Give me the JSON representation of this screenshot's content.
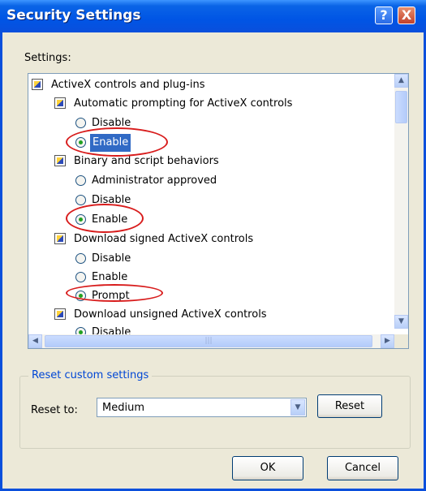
{
  "window": {
    "title": "Security Settings",
    "help_label": "?",
    "close_label": "X"
  },
  "settings_label": "Settings:",
  "tree": {
    "root": "ActiveX controls and plug-ins",
    "categories": [
      {
        "label": "Automatic prompting for ActiveX controls",
        "options": [
          {
            "label": "Disable",
            "checked": false
          },
          {
            "label": "Enable",
            "checked": true,
            "selected": true
          }
        ]
      },
      {
        "label": "Binary and script behaviors",
        "options": [
          {
            "label": "Administrator approved",
            "checked": false
          },
          {
            "label": "Disable",
            "checked": false
          },
          {
            "label": "Enable",
            "checked": true
          }
        ]
      },
      {
        "label": "Download signed ActiveX controls",
        "options": [
          {
            "label": "Disable",
            "checked": false
          },
          {
            "label": "Enable",
            "checked": false
          },
          {
            "label": "Prompt",
            "checked": true
          }
        ]
      },
      {
        "label": "Download unsigned ActiveX controls",
        "options": [
          {
            "label": "Disable",
            "checked": true
          }
        ]
      }
    ]
  },
  "scrollbar_icons": {
    "up": "arrow-up-icon",
    "down": "arrow-down-icon",
    "left": "arrow-left-icon",
    "right": "arrow-right-icon"
  },
  "reset_group": {
    "legend": "Reset custom settings",
    "reset_to_label": "Reset to:",
    "selected_level": "Medium",
    "reset_button": "Reset"
  },
  "buttons": {
    "ok": "OK",
    "cancel": "Cancel"
  },
  "colors": {
    "title_bar": "#0a4fdc",
    "dialog_bg": "#ece9d8",
    "selection": "#316ac5",
    "annotation": "#d81c1c",
    "group_legend": "#0046d5"
  }
}
